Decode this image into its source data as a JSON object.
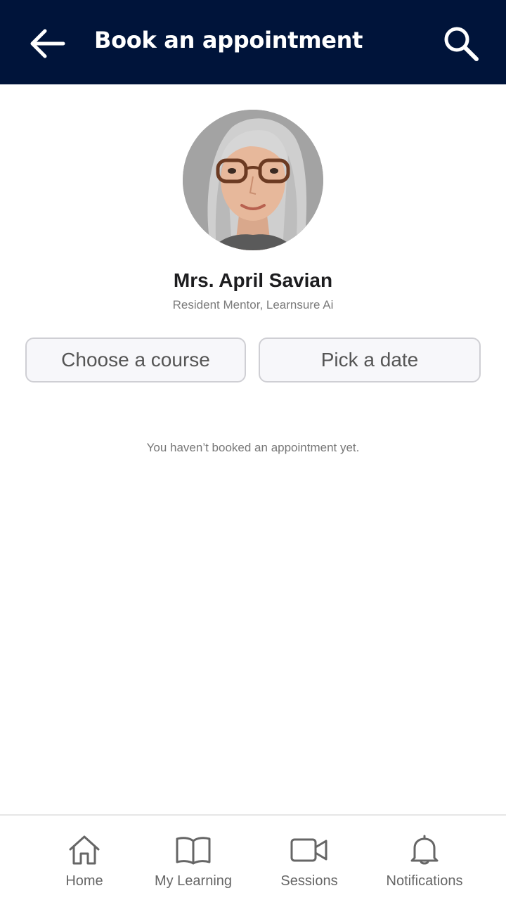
{
  "header": {
    "title": "Book an appointment",
    "back_icon": "arrow-left-icon",
    "search_icon": "search-icon",
    "background": "#00143a"
  },
  "mentor": {
    "name": "Mrs. April Savian",
    "role": "Resident Mentor, Learnsure Ai"
  },
  "actions": {
    "course_label": "Choose a course",
    "date_label": "Pick a date"
  },
  "empty_state": {
    "message": "You haven’t booked an appointment yet."
  },
  "bottom_nav": {
    "items": [
      {
        "label": "Home",
        "icon": "home-icon"
      },
      {
        "label": "My Learning",
        "icon": "book-icon"
      },
      {
        "label": "Sessions",
        "icon": "video-icon"
      },
      {
        "label": "Notifications",
        "icon": "bell-icon"
      }
    ]
  }
}
